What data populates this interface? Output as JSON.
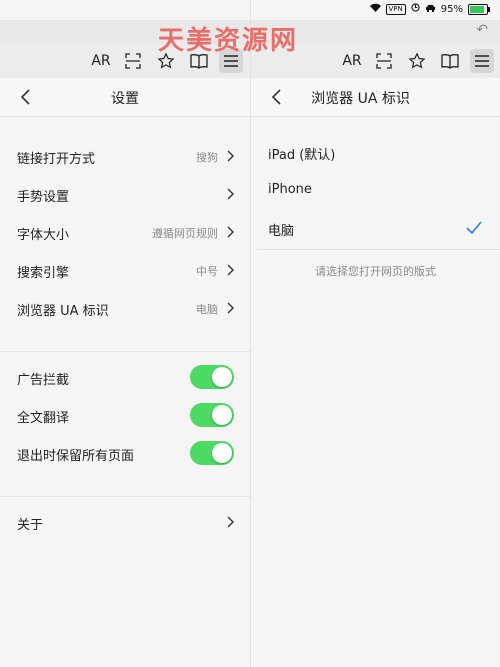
{
  "status_bar": {
    "battery": "95%",
    "vpn": "VPN"
  },
  "toolbar": {
    "reader_label": "AR"
  },
  "left": {
    "title": "设置",
    "rows": [
      {
        "label": "链接打开方式",
        "value": "搜狗"
      },
      {
        "label": "手势设置",
        "value": ""
      },
      {
        "label": "字体大小",
        "value": "遵循网页规则"
      },
      {
        "label": "搜索引擎",
        "value": "中号"
      },
      {
        "label": "浏览器 UA 标识",
        "value": "电脑"
      }
    ],
    "toggles": [
      {
        "label": "广告拦截",
        "on": true
      },
      {
        "label": "全文翻译",
        "on": true
      },
      {
        "label": "退出时保留所有页面",
        "on": true
      }
    ],
    "about": "关于"
  },
  "right": {
    "title": "浏览器 UA 标识",
    "options": [
      {
        "label": "iPad (默认)",
        "selected": false
      },
      {
        "label": "iPhone",
        "selected": false
      },
      {
        "label": "电脑",
        "selected": true
      }
    ],
    "hint": "请选择您打开网页的版式"
  },
  "watermark": "天美资源网",
  "colors": {
    "toggle_on": "#4cd964",
    "check": "#2f7fe0"
  }
}
